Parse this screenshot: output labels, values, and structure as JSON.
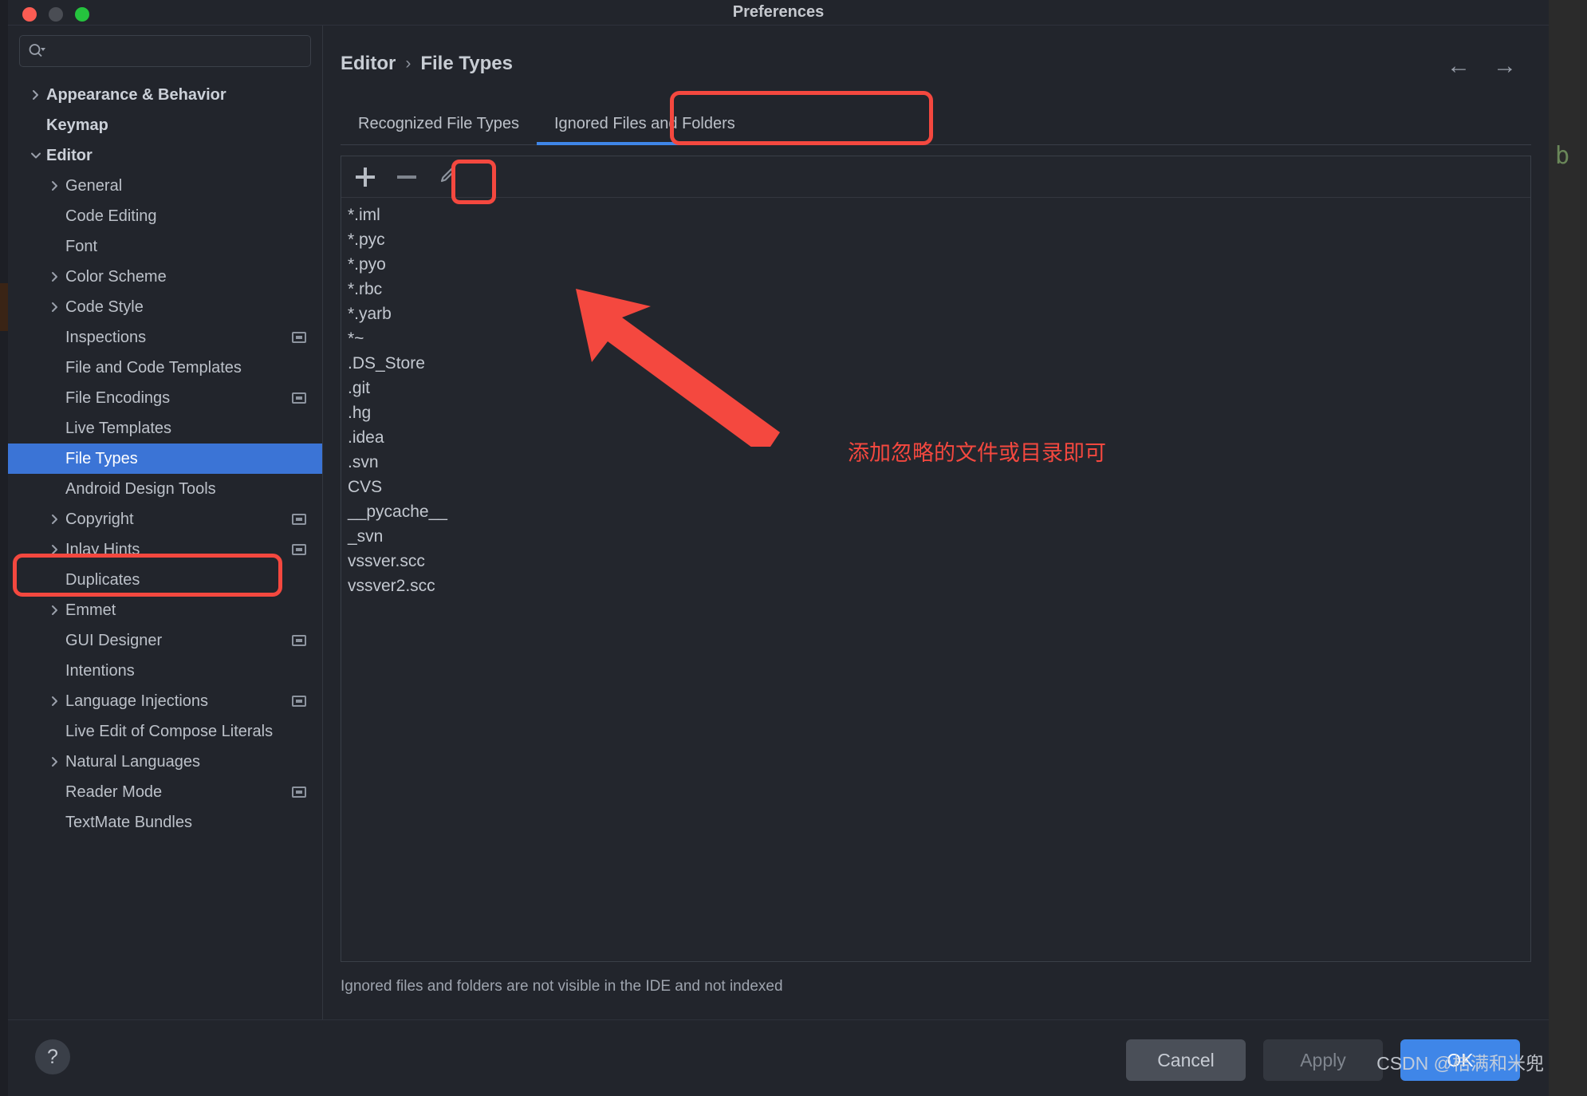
{
  "window": {
    "title": "Preferences",
    "traffic_lights": [
      "close-red",
      "minimize-yellow",
      "maximize-green"
    ]
  },
  "sidebar": {
    "search": {
      "value": "",
      "placeholder": ""
    },
    "items": [
      {
        "label": "Appearance & Behavior",
        "level": 0,
        "twisty": "right",
        "bold": true,
        "selected": false,
        "badge": false
      },
      {
        "label": "Keymap",
        "level": 0,
        "twisty": "none",
        "bold": true,
        "selected": false,
        "badge": false
      },
      {
        "label": "Editor",
        "level": 0,
        "twisty": "down",
        "bold": true,
        "selected": false,
        "badge": false
      },
      {
        "label": "General",
        "level": 1,
        "twisty": "right",
        "bold": false,
        "selected": false,
        "badge": false
      },
      {
        "label": "Code Editing",
        "level": 1,
        "twisty": "none",
        "bold": false,
        "selected": false,
        "badge": false
      },
      {
        "label": "Font",
        "level": 1,
        "twisty": "none",
        "bold": false,
        "selected": false,
        "badge": false
      },
      {
        "label": "Color Scheme",
        "level": 1,
        "twisty": "right",
        "bold": false,
        "selected": false,
        "badge": false
      },
      {
        "label": "Code Style",
        "level": 1,
        "twisty": "right",
        "bold": false,
        "selected": false,
        "badge": false
      },
      {
        "label": "Inspections",
        "level": 1,
        "twisty": "none",
        "bold": false,
        "selected": false,
        "badge": true
      },
      {
        "label": "File and Code Templates",
        "level": 1,
        "twisty": "none",
        "bold": false,
        "selected": false,
        "badge": false
      },
      {
        "label": "File Encodings",
        "level": 1,
        "twisty": "none",
        "bold": false,
        "selected": false,
        "badge": true
      },
      {
        "label": "Live Templates",
        "level": 1,
        "twisty": "none",
        "bold": false,
        "selected": false,
        "badge": false
      },
      {
        "label": "File Types",
        "level": 1,
        "twisty": "none",
        "bold": false,
        "selected": true,
        "badge": false
      },
      {
        "label": "Android Design Tools",
        "level": 1,
        "twisty": "none",
        "bold": false,
        "selected": false,
        "badge": false
      },
      {
        "label": "Copyright",
        "level": 1,
        "twisty": "right",
        "bold": false,
        "selected": false,
        "badge": true
      },
      {
        "label": "Inlay Hints",
        "level": 1,
        "twisty": "right",
        "bold": false,
        "selected": false,
        "badge": true
      },
      {
        "label": "Duplicates",
        "level": 1,
        "twisty": "none",
        "bold": false,
        "selected": false,
        "badge": false
      },
      {
        "label": "Emmet",
        "level": 1,
        "twisty": "right",
        "bold": false,
        "selected": false,
        "badge": false
      },
      {
        "label": "GUI Designer",
        "level": 1,
        "twisty": "none",
        "bold": false,
        "selected": false,
        "badge": true
      },
      {
        "label": "Intentions",
        "level": 1,
        "twisty": "none",
        "bold": false,
        "selected": false,
        "badge": false
      },
      {
        "label": "Language Injections",
        "level": 1,
        "twisty": "right",
        "bold": false,
        "selected": false,
        "badge": true
      },
      {
        "label": "Live Edit of Compose Literals",
        "level": 1,
        "twisty": "none",
        "bold": false,
        "selected": false,
        "badge": false
      },
      {
        "label": "Natural Languages",
        "level": 1,
        "twisty": "right",
        "bold": false,
        "selected": false,
        "badge": false
      },
      {
        "label": "Reader Mode",
        "level": 1,
        "twisty": "none",
        "bold": false,
        "selected": false,
        "badge": true
      },
      {
        "label": "TextMate Bundles",
        "level": 1,
        "twisty": "none",
        "bold": false,
        "selected": false,
        "badge": false
      }
    ]
  },
  "main": {
    "breadcrumb": {
      "parent": "Editor",
      "separator": "›",
      "current": "File Types"
    },
    "nav": {
      "back": "←",
      "forward": "→"
    },
    "tabs": [
      {
        "label": "Recognized File Types",
        "active": false
      },
      {
        "label": "Ignored Files and Folders",
        "active": true
      }
    ],
    "toolbar": {
      "add_label": "+",
      "remove_label": "−",
      "edit_label": "edit-pencil"
    },
    "ignored_list": [
      "*.iml",
      "*.pyc",
      "*.pyo",
      "*.rbc",
      "*.yarb",
      "*~",
      ".DS_Store",
      ".git",
      ".hg",
      ".idea",
      ".svn",
      "CVS",
      "__pycache__",
      "_svn",
      "vssver.scc",
      "vssver2.scc"
    ],
    "hint": "Ignored files and folders are not visible in the IDE and not indexed"
  },
  "footer": {
    "help_label": "?",
    "cancel_label": "Cancel",
    "apply_label": "Apply",
    "ok_label": "OK"
  },
  "annotations": {
    "chinese_note": "添加忽略的文件或目录即可",
    "color": "#f4483f"
  },
  "watermark": {
    "text": "CSDN @桔满和米兜"
  },
  "background_editor": {
    "visible_code": "b"
  }
}
